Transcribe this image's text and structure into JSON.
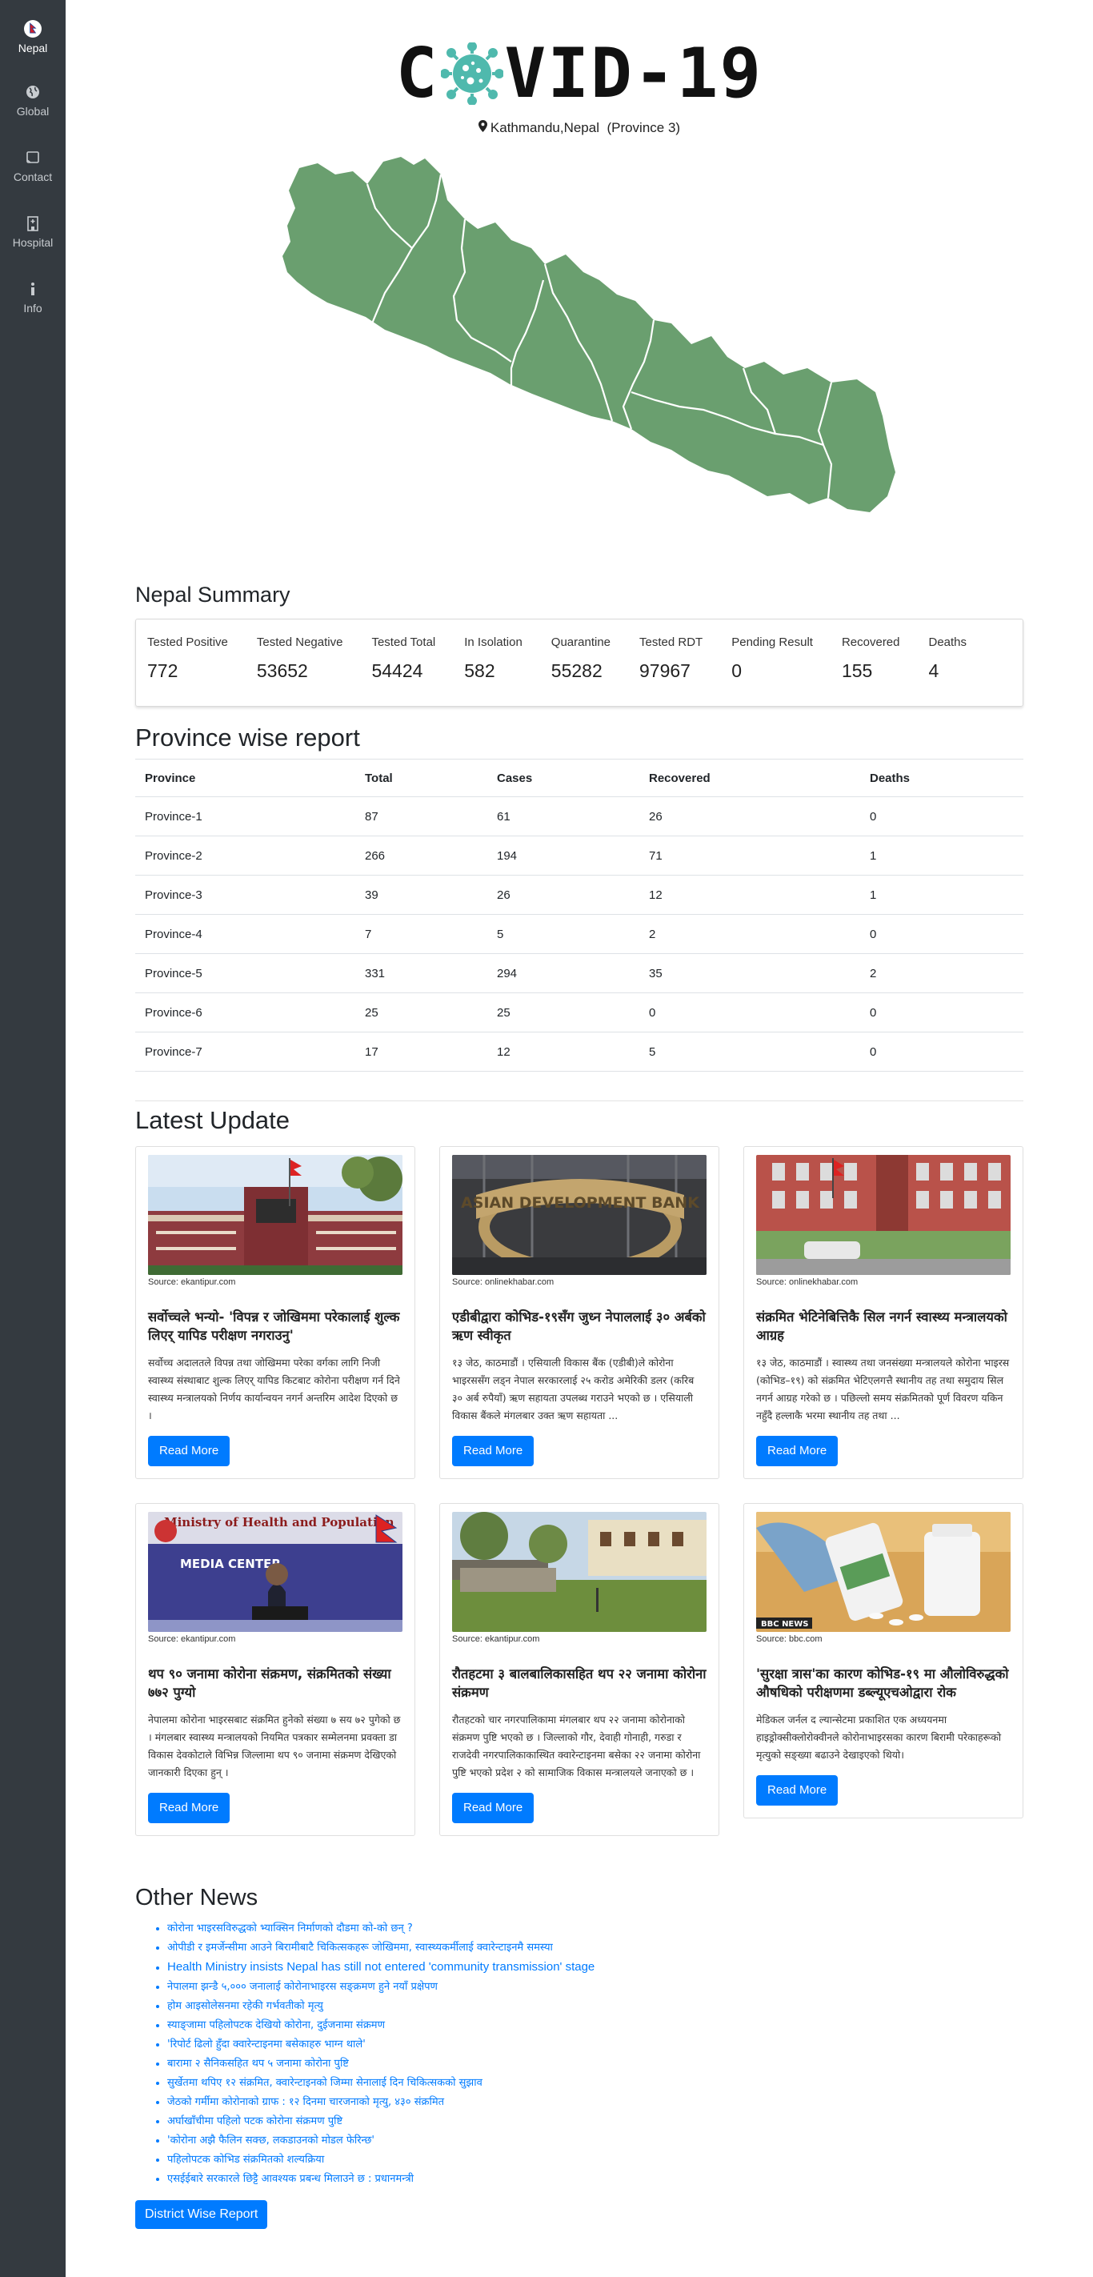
{
  "sidebar": {
    "items": [
      {
        "label": "Nepal",
        "icon": "nepal-flag-icon",
        "active": true
      },
      {
        "label": "Global",
        "icon": "globe-icon",
        "active": false
      },
      {
        "label": "Contact",
        "icon": "contact-card-icon",
        "active": false
      },
      {
        "label": "Hospital",
        "icon": "hospital-icon",
        "active": false
      },
      {
        "label": "Info",
        "icon": "info-icon",
        "active": false
      }
    ]
  },
  "header": {
    "logo_left": "C",
    "logo_right": "VID-19",
    "location": "Kathmandu,Nepal  (Province 3)"
  },
  "summary": {
    "title": "Nepal Summary",
    "stats": [
      {
        "label": "Tested Positive",
        "value": "772"
      },
      {
        "label": "Tested Negative",
        "value": "53652"
      },
      {
        "label": "Tested Total",
        "value": "54424"
      },
      {
        "label": "In Isolation",
        "value": "582"
      },
      {
        "label": "Quarantine",
        "value": "55282"
      },
      {
        "label": "Tested RDT",
        "value": "97967"
      },
      {
        "label": "Pending Result",
        "value": "0"
      },
      {
        "label": "Recovered",
        "value": "155"
      },
      {
        "label": "Deaths",
        "value": "4"
      }
    ]
  },
  "province": {
    "title": "Province wise report",
    "columns": [
      "Province",
      "Total",
      "Cases",
      "Recovered",
      "Deaths"
    ],
    "rows": [
      [
        "Province-1",
        "87",
        "61",
        "26",
        "0"
      ],
      [
        "Province-2",
        "266",
        "194",
        "71",
        "1"
      ],
      [
        "Province-3",
        "39",
        "26",
        "12",
        "1"
      ],
      [
        "Province-4",
        "7",
        "5",
        "2",
        "0"
      ],
      [
        "Province-5",
        "331",
        "294",
        "35",
        "2"
      ],
      [
        "Province-6",
        "25",
        "25",
        "0",
        "0"
      ],
      [
        "Province-7",
        "17",
        "12",
        "5",
        "0"
      ]
    ]
  },
  "latest": {
    "title": "Latest Update",
    "read_more": "Read More",
    "cards": [
      {
        "source": "Source: ekantipur.com",
        "title": "सर्वोच्चले भन्यो- 'विपन्न र जोखिममा परेकालाई शुल्क लिएर् यापिड परीक्षण नगराउनु'",
        "text": "सर्वोच्च अदालतले विपन्न तथा जोखिममा परेका वर्गका लागि निजी स्वास्थ्य संस्थाबाट शुल्क लिएर् यापिड किटबाट कोरोना परीक्षण गर्न दिने स्वास्थ्य मन्त्रालयको निर्णय कार्यान्वयन नगर्न अन्तरिम आदेश दिएको छ ।"
      },
      {
        "source": "Source: onlinekhabar.com",
        "title": "एडीबीद्वारा कोभिड-१९सँग जुध्न नेपाललाई ३० अर्बको ऋण स्वीकृत",
        "text": "१३ जेठ, काठमाडौं । एसियाली विकास बैंक (एडीबी)ले कोरोना भाइरससँग लड्न नेपाल सरकारलाई २५ करोड अमेरिकी डलर (करिब ३० अर्ब रुपैयाँ) ऋण सहायता उपलब्ध गराउने भएको छ । एसियाली विकास बैंकले मंगलबार उक्त ऋण सहायता ..."
      },
      {
        "source": "Source: onlinekhabar.com",
        "title": "संक्रमित भेटिनेबित्तिकै सिल नगर्न स्वास्थ्य मन्त्रालयको आग्रह",
        "text": "१३ जेठ, काठमाडौं । स्वास्थ्य तथा जनसंख्या मन्त्रालयले कोरोना भाइरस (कोभिड–१९) को संक्रमित भेटिएलगत्तै स्थानीय तह तथा समुदाय सिल नगर्न आग्रह गरेको छ । पछिल्लो समय संक्रमितको पूर्ण विवरण यकिन नहुँदै हल्लाकै भरमा स्थानीय तह तथा ..."
      },
      {
        "source": "Source: ekantipur.com",
        "title": "थप ९० जनामा कोरोना संक्रमण, संक्रमितको संख्या ७७२ पुग्यो",
        "text": "नेपालमा कोरोना भाइरसबाट संक्रमित हुनेको संख्या ७ सय ७२ पुगेको छ । मंगलबार स्वास्थ्य मन्त्रालयको नियमित पत्रकार सम्मेलनमा प्रवक्ता डा विकास देवकोटाले विभिन्न जिल्लामा थप ९० जनामा संक्रमण देखिएको जानकारी दिएका हुन् ।"
      },
      {
        "source": "Source: ekantipur.com",
        "title": "रौतहटमा ३ बालबालिकासहित थप २२ जनामा कोरोना संक्रमण",
        "text": "रौतहटको चार नगरपालिकामा मंगलबार थप २२ जनामा कोरोनाको संक्रमण पुष्टि भएको छ । जिल्लाको गौर, देवाही गोनाही, गरुडा र राजदेवी नगरपालिकाकास्थित क्वारेन्टाइनमा बसेका २२ जनामा कोरोना पुष्टि भएको प्रदेश २ को सामाजिक विकास मन्त्रालयले जनाएको छ ।"
      },
      {
        "source": "Source: bbc.com",
        "title": "'सुरक्षा त्रास'का कारण कोभिड-१९ मा औलोविरुद्धको औषधिको परीक्षणमा डब्ल्यूएचओद्वारा रोक",
        "text": "मेडिकल जर्नल द ल्यान्सेटमा प्रकाशित एक अध्ययनमा हाइड्रोक्सीक्लोरोक्वीनले कोरोनाभाइरसका कारण बिरामी परेकाहरूको मृत्युको सङ्ख्या बढाउने देखाइएको थियो।"
      }
    ]
  },
  "other": {
    "title": "Other News",
    "items": [
      "कोरोना भाइरसविरुद्धको भ्याक्सिन निर्माणको दौडमा को-को छन् ?",
      "ओपीडी र इमर्जेन्सीमा आउने बिरामीबाटै चिकित्सकहरू जोखिममा, स्वास्थ्यकर्मीलाई क्वारेन्टाइनमै समस्या",
      "Health Ministry insists Nepal has still not entered 'community transmission' stage",
      "नेपालमा झन्डै ५,००० जनालाई कोरोनाभाइरस सङ्क्रमण हुने नयाँ प्रक्षेपण",
      "होम आइसोलेसनमा रहेकी गर्भवतीको मृत्यु",
      "स्याङ्जामा पहिलोपटक देखियो कोरोना, दुईजनामा संक्रमण",
      "'रिपोर्ट ढिलो हुँदा क्वारेन्टाइनमा बसेकाहरु भाग्न थाले'",
      "बारामा २ सैनिकसहित थप ५ जनामा कोरोना पुष्टि",
      "सुर्खेतमा थपिए १२ संक्रमित, क्वारेन्टाइनको जिम्मा सेनालाई दिन चिकित्सकको सुझाव",
      "जेठको गर्मीमा कोरोनाको ग्राफ : १२ दिनमा चारजनाको मृत्यु, ४३० संक्रमित",
      "अर्घाखाँचीमा पहिलो पटक कोरोना संक्रमण पुष्टि",
      "'कोरोना अझै फैलिन सक्छ, लकडाउनको मोडल फेरिन्छ'",
      "पहिलोपटक कोभिड संक्रमितको शल्यक्रिया",
      "एसईईबारे सरकारले छिट्टै आवश्यक प्रबन्ध मिलाउने छ : प्रधानमन्त्री"
    ],
    "button": "District Wise Report"
  },
  "colors": {
    "sidebar_bg": "#343a40",
    "map_fill": "#6a9f6f",
    "virus": "#4fb9ad",
    "primary": "#007bff"
  }
}
